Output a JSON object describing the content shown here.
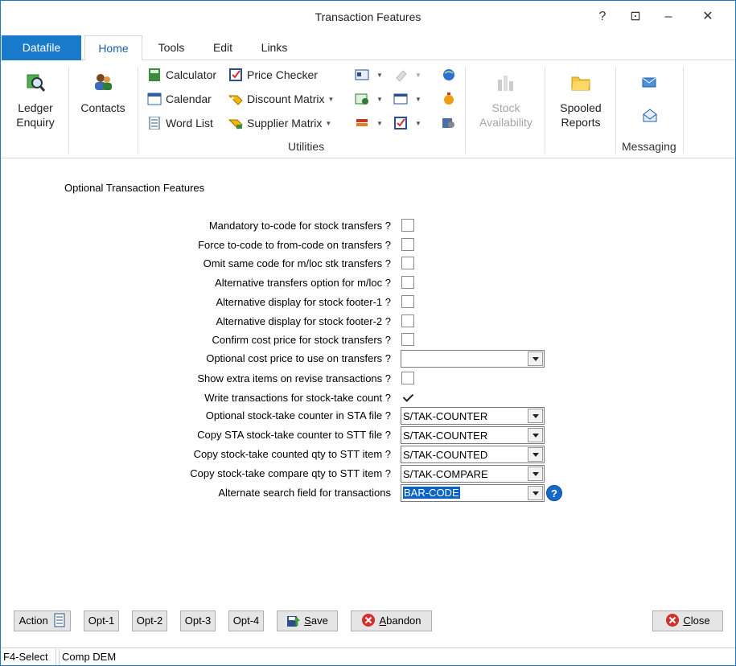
{
  "window": {
    "title": "Transaction Features",
    "help": "?",
    "restore": "⊡",
    "minimize": "–",
    "close": "✕"
  },
  "tabs": [
    {
      "label": "Datafile"
    },
    {
      "label": "Home"
    },
    {
      "label": "Tools"
    },
    {
      "label": "Edit"
    },
    {
      "label": "Links"
    }
  ],
  "ribbon": {
    "ledger_enquiry": "Ledger\nEnquiry",
    "contacts": "Contacts",
    "calculator": "Calculator",
    "calendar": "Calendar",
    "word_list": "Word List",
    "price_checker": "Price Checker",
    "discount_matrix": "Discount Matrix",
    "supplier_matrix": "Supplier Matrix",
    "utilities_label": "Utilities",
    "stock_availability": "Stock\nAvailability",
    "spooled_reports": "Spooled\nReports",
    "messaging_label": "Messaging"
  },
  "form": {
    "section_title": "Optional Transaction Features",
    "rows": [
      {
        "label": "Mandatory to-code for stock transfers ?",
        "type": "checkbox",
        "checked": false
      },
      {
        "label": "Force to-code to from-code on transfers ?",
        "type": "checkbox",
        "checked": false
      },
      {
        "label": "Omit same code for m/loc stk transfers ?",
        "type": "checkbox",
        "checked": false
      },
      {
        "label": "Alternative transfers option for m/loc ?",
        "type": "checkbox",
        "checked": false
      },
      {
        "label": "Alternative display for stock footer-1 ?",
        "type": "checkbox",
        "checked": false
      },
      {
        "label": "Alternative display for stock footer-2 ?",
        "type": "checkbox",
        "checked": false
      },
      {
        "label": "Confirm cost price for stock transfers ?",
        "type": "checkbox",
        "checked": false
      },
      {
        "label": "Optional cost price to use on transfers ?",
        "type": "combo",
        "value": ""
      },
      {
        "label": "Show extra items on revise transactions ?",
        "type": "checkbox",
        "checked": false
      },
      {
        "label": "Write transactions for stock-take count ?",
        "type": "checkbox",
        "checked": true
      },
      {
        "label": "Optional stock-take counter in STA file ?",
        "type": "combo",
        "value": "S/TAK-COUNTER"
      },
      {
        "label": "Copy STA stock-take counter to STT file ?",
        "type": "combo",
        "value": "S/TAK-COUNTER"
      },
      {
        "label": "Copy stock-take counted qty to STT item ?",
        "type": "combo",
        "value": "S/TAK-COUNTED"
      },
      {
        "label": "Copy stock-take compare qty to STT item ?",
        "type": "combo",
        "value": "S/TAK-COMPARE"
      },
      {
        "label": "Alternate search field for transactions",
        "type": "combo",
        "value": "BAR-CODE",
        "selected": true,
        "help": "?"
      }
    ]
  },
  "buttons": {
    "action": "Action",
    "opt1": "Opt-1",
    "opt2": "Opt-2",
    "opt3": "Opt-3",
    "opt4": "Opt-4",
    "save_u": "S",
    "save_rest": "ave",
    "abandon_u": "A",
    "abandon_rest": "bandon",
    "close_u": "C",
    "close_rest": "lose"
  },
  "status": {
    "key": "F4-Select",
    "company": "Comp DEM"
  },
  "colors": {
    "accent": "#1979ca",
    "selection": "#0a64c8"
  }
}
